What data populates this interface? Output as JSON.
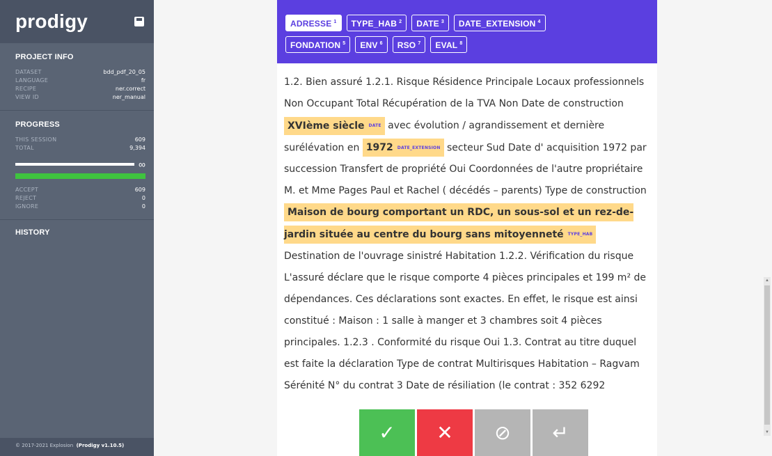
{
  "sidebar": {
    "logo": "prodigy",
    "project_info": {
      "title": "PROJECT INFO",
      "rows": [
        {
          "k": "DATASET",
          "v": "bdd_pdf_20_05"
        },
        {
          "k": "LANGUAGE",
          "v": "fr"
        },
        {
          "k": "RECIPE",
          "v": "ner.correct"
        },
        {
          "k": "VIEW ID",
          "v": "ner_manual"
        }
      ]
    },
    "progress": {
      "title": "PROGRESS",
      "session_label": "THIS SESSION",
      "session": "609",
      "total_label": "TOTAL",
      "total": "9,394",
      "infinity": "∞",
      "accept_label": "ACCEPT",
      "accept": "609",
      "reject_label": "REJECT",
      "reject": "0",
      "ignore_label": "IGNORE",
      "ignore": "0"
    },
    "history_title": "HISTORY",
    "footer_prefix": "© 2017-2021 Explosion",
    "footer_version": "(Prodigy v1.10.5)"
  },
  "labels": [
    {
      "name": "ADRESSE",
      "key": "1",
      "active": true
    },
    {
      "name": "TYPE_HAB",
      "key": "2"
    },
    {
      "name": "DATE",
      "key": "3"
    },
    {
      "name": "DATE_EXTENSION",
      "key": "4"
    },
    {
      "name": "FONDATION",
      "key": "5"
    },
    {
      "name": "ENV",
      "key": "6"
    },
    {
      "name": "RSO",
      "key": "7"
    },
    {
      "name": "EVAL",
      "key": "8"
    }
  ],
  "text": {
    "t1": "1.2. Bien assuré 1.2.1. Risque Résidence Principale Locaux professionnels Non Occupant Total Récupération de la TVA Non Date de construction ",
    "e1": "XVIème siècle",
    "e1_tag": "DATE",
    "t2": " avec évolution / agrandissement et dernière surélévation en ",
    "e2": "1972",
    "e2_tag": "DATE_EXTENSION",
    "t3": " secteur Sud Date d' acquisition 1972 par succession Transfert de propriété Oui Coordonnées de l'autre propriétaire M. et Mme Pages Paul et Rachel ( décédés – parents) Type de construction ",
    "e3": "Maison de bourg comportant un RDC, un sous-sol et un rez-de-jardin située au centre du bourg sans mitoyenneté",
    "e3_tag": "TYPE_HAB",
    "t4": " Destination de l'ouvrage sinistré Habitation 1.2.2. Vérification du risque L'assuré déclare que le risque comporte 4 pièces principales et 199 m² de dépendances. Ces déclarations sont exactes. En effet, le risque est ainsi constitué : Maison : 1 salle à manger et 3 chambres soit 4 pièces principales. 1.2.3 . Conformité du risque Oui 1.3. Contrat au titre duquel est faite la déclaration Type de contrat Multirisques Habitation – Ragvam Sérénité N° du contrat 3 Date de résiliation (le contrat : 352 6292"
  },
  "actions": {
    "accept": "✓",
    "reject": "✕",
    "ignore": "⊘",
    "undo": "↵"
  },
  "colors": {
    "label_bar": "#5b3fe0",
    "entity": "#ffd98a",
    "accept": "#4cc055",
    "reject": "#ee3a44"
  }
}
